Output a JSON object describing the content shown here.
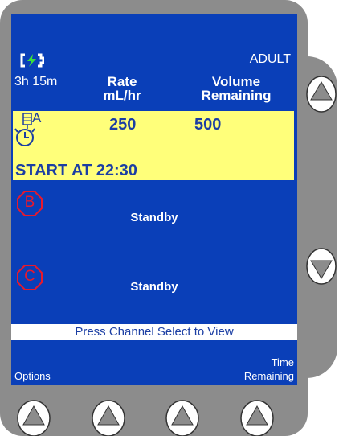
{
  "status": {
    "battery_time": "3h 15m",
    "patient_mode": "ADULT"
  },
  "headers": {
    "rate_line1": "Rate",
    "rate_line2": "mL/hr",
    "volume_line1": "Volume",
    "volume_line2": "Remaining"
  },
  "channel_a": {
    "letter": "A",
    "rate": "250",
    "volume": "500",
    "delayed_start": "START AT 22:30"
  },
  "channel_b": {
    "letter": "B",
    "status": "Standby"
  },
  "channel_c": {
    "letter": "C",
    "status": "Standby"
  },
  "prompt": "Press Channel Select to View",
  "softkeys": {
    "left_label": "Options",
    "right_label_line1": "Time",
    "right_label_line2": "Remaining"
  },
  "colors": {
    "screen": "#0a3fb8",
    "highlight": "#ffff7a",
    "alarm_red": "#e8192c",
    "battery_green": "#3be03b"
  },
  "icons": [
    "battery-charging-icon",
    "clock-icon",
    "iv-bag-icon",
    "channel-b-octagon-icon",
    "channel-c-octagon-icon",
    "arrow-up-icon",
    "arrow-down-icon"
  ]
}
